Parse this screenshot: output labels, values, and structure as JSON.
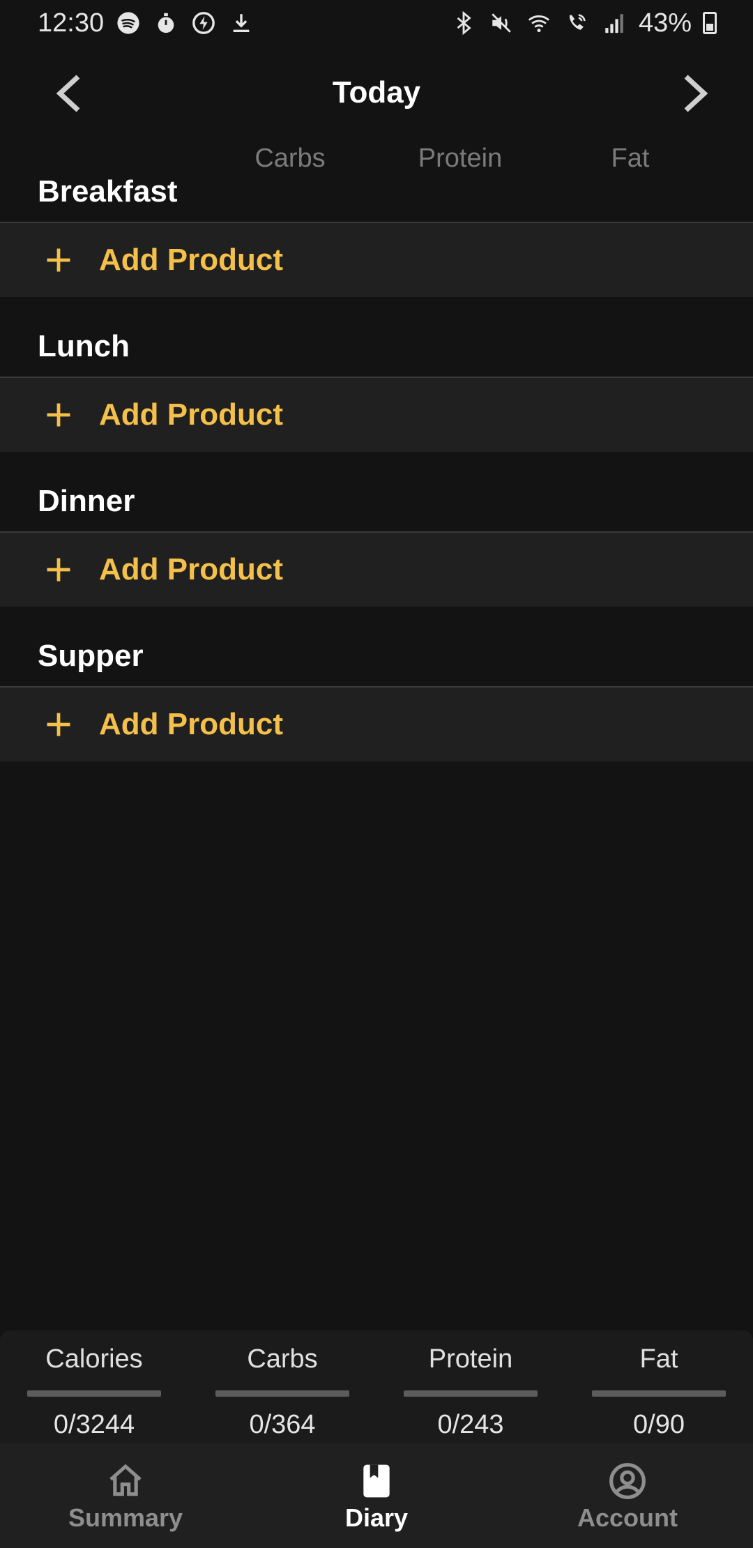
{
  "status_bar": {
    "time": "12:30",
    "battery": "43%",
    "left_icons": [
      "spotify-icon",
      "timer-icon",
      "flash-icon",
      "download-icon"
    ],
    "right_icons": [
      "bluetooth-icon",
      "mute-icon",
      "wifi-icon",
      "wifi-call-icon",
      "signal-icon",
      "battery-icon"
    ]
  },
  "header": {
    "title": "Today",
    "prev_icon": "chevron-left-icon",
    "next_icon": "chevron-right-icon"
  },
  "columns": [
    "Carbs",
    "Protein",
    "Fat"
  ],
  "meals": [
    {
      "title": "Breakfast",
      "add_label": "Add Product"
    },
    {
      "title": "Lunch",
      "add_label": "Add Product"
    },
    {
      "title": "Dinner",
      "add_label": "Add Product"
    },
    {
      "title": "Supper",
      "add_label": "Add Product"
    }
  ],
  "macros": [
    {
      "name": "Calories",
      "value": "0/3244",
      "progress": 0
    },
    {
      "name": "Carbs",
      "value": "0/364",
      "progress": 0
    },
    {
      "name": "Protein",
      "value": "0/243",
      "progress": 0
    },
    {
      "name": "Fat",
      "value": "0/90",
      "progress": 0
    }
  ],
  "bottom_nav": [
    {
      "label": "Summary",
      "icon": "home-icon",
      "active": false
    },
    {
      "label": "Diary",
      "icon": "book-icon",
      "active": true
    },
    {
      "label": "Account",
      "icon": "account-circle-icon",
      "active": false
    }
  ],
  "colors": {
    "background": "#131313",
    "accent": "#f5c04a",
    "row_background": "#202020"
  }
}
